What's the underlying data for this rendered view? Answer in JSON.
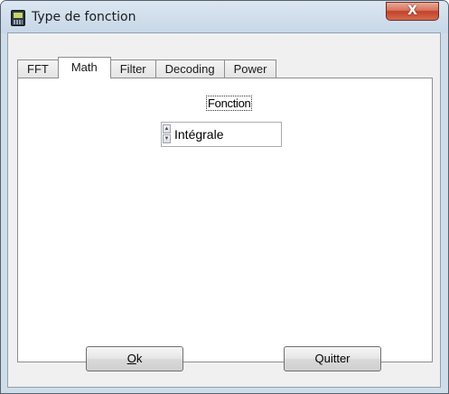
{
  "window": {
    "title": "Type de fonction",
    "close_glyph": "X"
  },
  "tabs": [
    {
      "label": "FFT"
    },
    {
      "label": "Math",
      "active": true
    },
    {
      "label": "Filter"
    },
    {
      "label": "Decoding"
    },
    {
      "label": "Power"
    }
  ],
  "panel": {
    "label": "Fonction",
    "spinner": {
      "value": "Intégrale",
      "up_glyph": "▲",
      "down_glyph": "▼"
    }
  },
  "buttons": {
    "ok_mnemonic": "O",
    "ok_rest": "k",
    "quit": "Quitter"
  },
  "colors": {
    "close_button": "#c4412a",
    "frame": "#cfdde9"
  },
  "icons": {
    "app": "calculator-icon",
    "close": "close-icon"
  }
}
